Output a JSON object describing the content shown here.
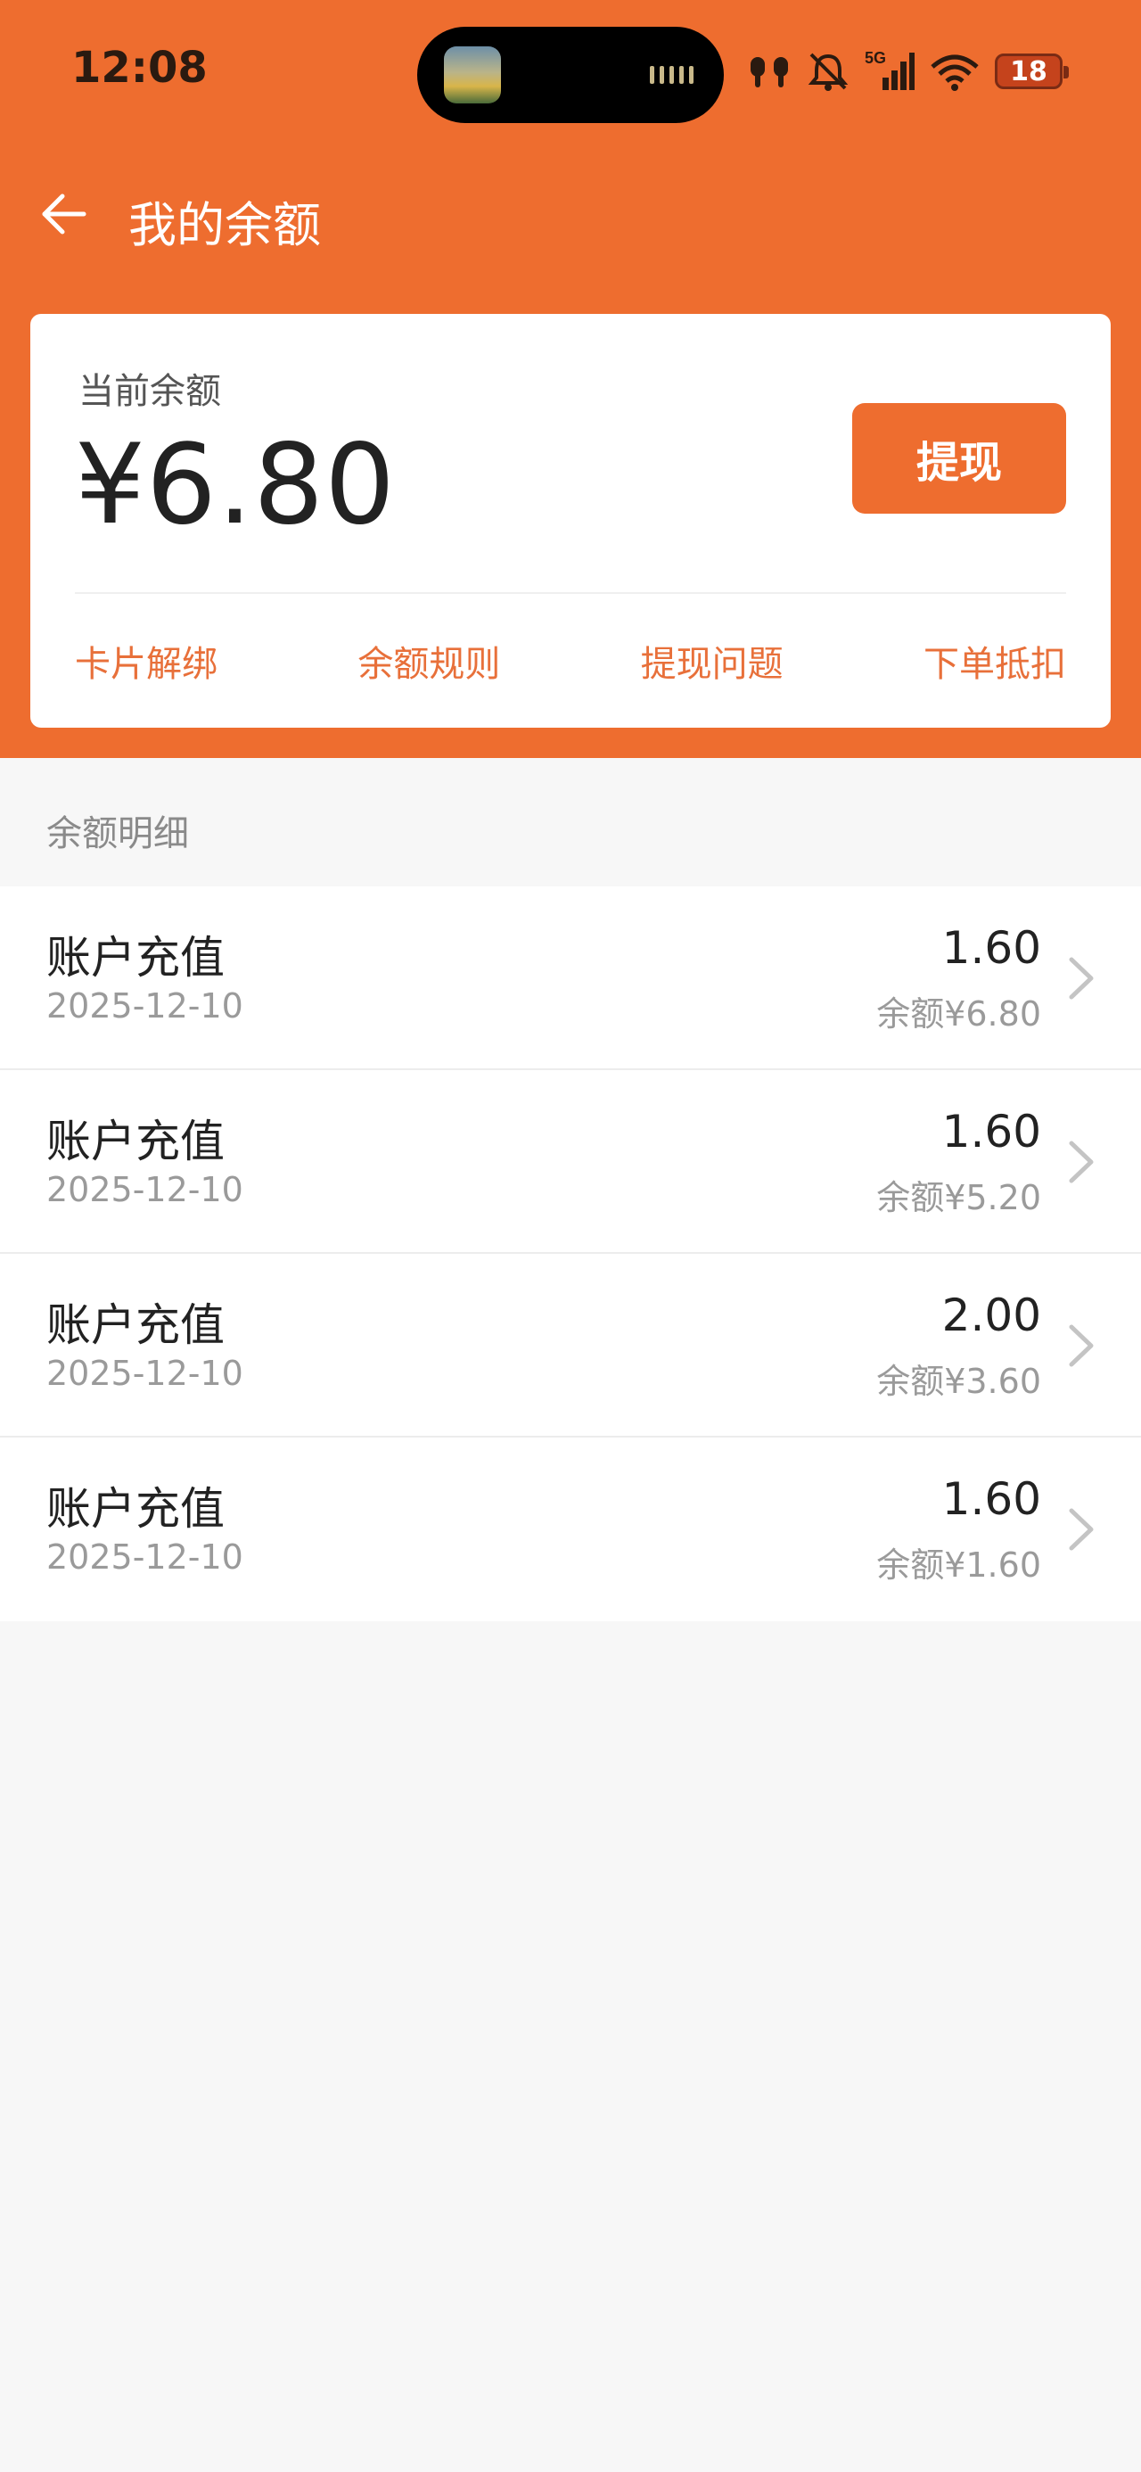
{
  "status_bar": {
    "time": "12:08",
    "network": "5G",
    "battery": "18",
    "icons": [
      "headphones-icon",
      "bell-muted-icon",
      "signal-icon",
      "wifi-icon",
      "battery-icon"
    ]
  },
  "nav": {
    "back_icon": "back-arrow-icon",
    "title": "我的余额"
  },
  "balance_card": {
    "label": "当前余额",
    "amount": "¥6.80",
    "withdraw_label": "提现",
    "links": [
      "卡片解绑",
      "余额规则",
      "提现问题",
      "下单抵扣"
    ]
  },
  "details": {
    "title": "余额明细",
    "rows": [
      {
        "title": "账户充值",
        "date": "2025-12-10",
        "amount": "1.60",
        "balance": "余额¥6.80"
      },
      {
        "title": "账户充值",
        "date": "2025-12-10",
        "amount": "1.60",
        "balance": "余额¥5.20"
      },
      {
        "title": "账户充值",
        "date": "2025-12-10",
        "amount": "2.00",
        "balance": "余额¥3.60"
      },
      {
        "title": "账户充值",
        "date": "2025-12-10",
        "amount": "1.60",
        "balance": "余额¥1.60"
      }
    ]
  },
  "colors": {
    "brand": "#ee6d2f",
    "link": "#e8703a",
    "background": "#f7f7f7"
  }
}
